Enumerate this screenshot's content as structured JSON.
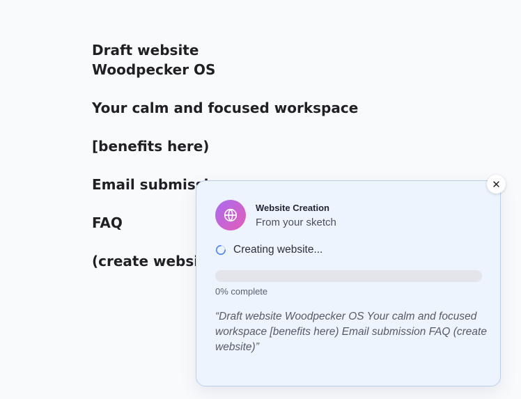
{
  "sketch": {
    "lines": [
      "Draft website",
      "Woodpecker OS",
      "Your calm and focused workspace",
      "[benefits here)",
      "Email submission",
      "FAQ",
      "(create website)"
    ]
  },
  "card": {
    "close_label": "✕",
    "title": "Website Creation",
    "subtitle": "From your sketch",
    "status": "Creating website...",
    "progress": 0,
    "progress_label": "0% complete",
    "quote": "“Draft website Woodpecker OS Your calm and focused workspace [benefits here) Email submission FAQ (create website)”"
  },
  "colors": {
    "card_bg": "#eef4fd",
    "card_border": "#b9cdec",
    "icon_gradient_start": "#a96cf0",
    "icon_gradient_end": "#e35db8",
    "spinner": "#5b8def"
  },
  "icons": {
    "app": "globe-icon",
    "status": "spinner-icon",
    "close": "close-icon"
  }
}
